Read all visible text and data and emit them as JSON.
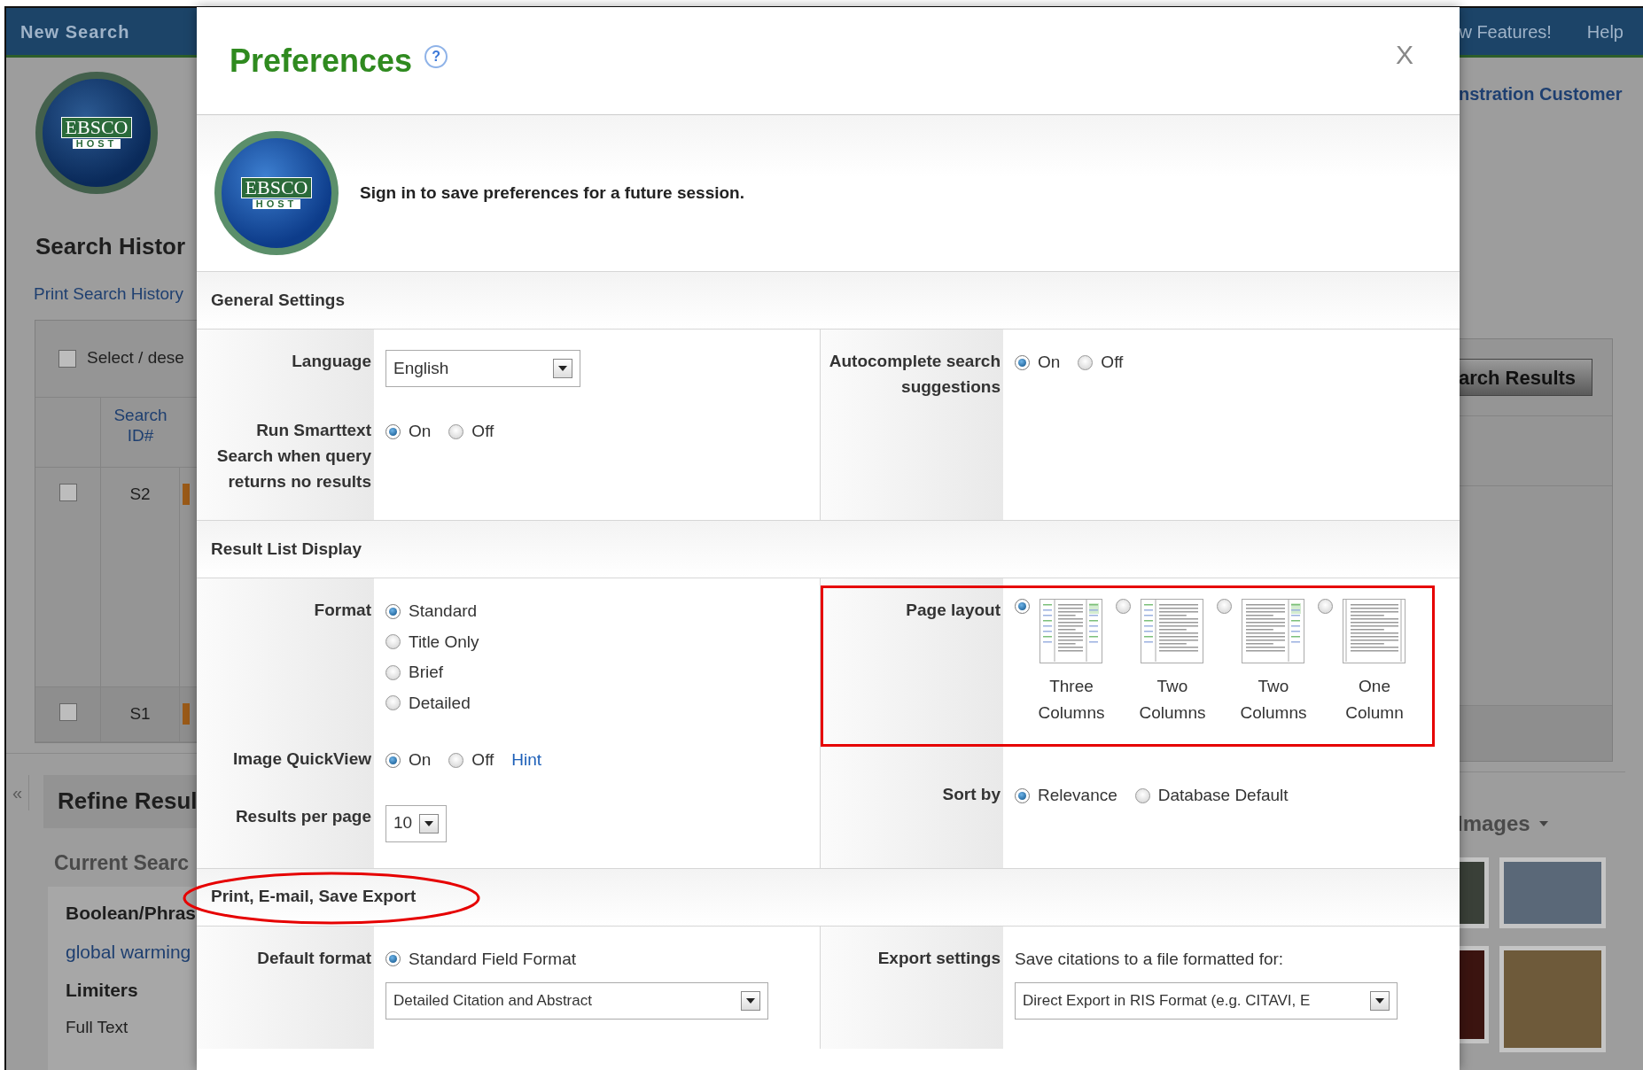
{
  "background": {
    "top_nav": {
      "left": [
        "New Search"
      ],
      "right": [
        "w Features!",
        "Help"
      ]
    },
    "logo": {
      "line1": "EBSCO",
      "line2": "HOST"
    },
    "user_name": "nstration Customer",
    "search_history": {
      "title": "Search Histor",
      "print_link": "Print Search History",
      "select_label": "Select / dese",
      "select_all_checked": false,
      "column_header": "Search ID#",
      "button": "arch Results",
      "rows": [
        {
          "id": "S2",
          "checked": false
        },
        {
          "id": "S1",
          "checked": false
        }
      ]
    },
    "collapse": "«",
    "refine": {
      "title": "Refine Resul",
      "current_search": "Current Searc",
      "boolean_label": "Boolean/Phras",
      "query": "global warming",
      "limiters": "Limiters",
      "limiter": "Full Text"
    },
    "images": {
      "title": "Images"
    }
  },
  "dialog": {
    "title": "Preferences",
    "help": "?",
    "close": "X",
    "logo": {
      "line1": "EBSCO",
      "line2": "HOST"
    },
    "signin_message": "Sign in to save preferences for a future session.",
    "sections": [
      {
        "title": "General Settings",
        "circled": false,
        "left": [
          {
            "label": "Language",
            "highlighted": false,
            "controls": [
              {
                "kind": "select",
                "value": "English"
              }
            ]
          },
          {
            "label": "Run Smarttext Search when query returns no results",
            "highlighted": false,
            "controls": [
              {
                "kind": "radio_row",
                "options": [
                  {
                    "label": "On",
                    "selected": true
                  },
                  {
                    "label": "Off",
                    "selected": false
                  }
                ]
              }
            ]
          }
        ],
        "right": [
          {
            "label": "Autocomplete search suggestions",
            "highlighted": false,
            "controls": [
              {
                "kind": "radio_row",
                "options": [
                  {
                    "label": "On",
                    "selected": true
                  },
                  {
                    "label": "Off",
                    "selected": false
                  }
                ]
              }
            ]
          }
        ]
      },
      {
        "title": "Result List Display",
        "circled": false,
        "left": [
          {
            "label": "Format",
            "highlighted": false,
            "controls": [
              {
                "kind": "radio_column",
                "options": [
                  {
                    "label": "Standard",
                    "selected": true
                  },
                  {
                    "label": "Title Only",
                    "selected": false
                  },
                  {
                    "label": "Brief",
                    "selected": false
                  },
                  {
                    "label": "Detailed",
                    "selected": false
                  }
                ]
              }
            ]
          },
          {
            "label": "Image QuickView",
            "highlighted": false,
            "controls": [
              {
                "kind": "radio_row",
                "options": [
                  {
                    "label": "On",
                    "selected": true
                  },
                  {
                    "label": "Off",
                    "selected": false
                  }
                ]
              },
              {
                "kind": "link",
                "text": "Hint"
              }
            ]
          },
          {
            "label": "Results per page",
            "highlighted": false,
            "controls": [
              {
                "kind": "select_small",
                "value": "10"
              }
            ]
          }
        ],
        "right": [
          {
            "label": "Page layout",
            "highlighted": true,
            "controls": [
              {
                "kind": "layouts",
                "options": [
                  {
                    "label": "Three Columns",
                    "kind": "three",
                    "selected": true
                  },
                  {
                    "label": "Two Columns",
                    "kind": "two_left",
                    "selected": false
                  },
                  {
                    "label": "Two Columns",
                    "kind": "two_right",
                    "selected": false
                  },
                  {
                    "label": "One Column",
                    "kind": "one",
                    "selected": false
                  }
                ]
              }
            ]
          },
          {
            "label": "Sort by",
            "highlighted": false,
            "controls": [
              {
                "kind": "radio_row",
                "options": [
                  {
                    "label": "Relevance",
                    "selected": true
                  },
                  {
                    "label": "Database Default",
                    "selected": false
                  }
                ]
              }
            ]
          }
        ]
      },
      {
        "title": "Print, E-mail, Save Export",
        "circled": true,
        "left": [
          {
            "label": "Default format",
            "highlighted": false,
            "controls": [
              {
                "kind": "radio_row",
                "options": [
                  {
                    "label": "Standard Field Format",
                    "selected": true
                  }
                ]
              },
              {
                "kind": "select_wide",
                "value": "Detailed Citation and Abstract"
              }
            ]
          }
        ],
        "right": [
          {
            "label": "Export settings",
            "highlighted": false,
            "controls": [
              {
                "kind": "text",
                "text": "Save citations to a file formatted for:"
              },
              {
                "kind": "select_wide",
                "value": "Direct Export in RIS Format (e.g. CITAVI, E"
              }
            ]
          }
        ]
      }
    ]
  }
}
